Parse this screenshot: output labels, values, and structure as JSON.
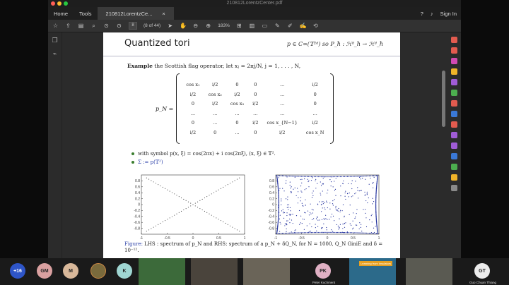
{
  "window": {
    "title": "210812LorentzCenter.pdf"
  },
  "topbar": {
    "home": "Home",
    "tools": "Tools",
    "tab_label": "210812LorentzCe...",
    "tab_close": "×",
    "sign_in": "Sign In"
  },
  "toolbar": {
    "page_number": "8",
    "page_total": "(8 of 44)",
    "zoom": "183%"
  },
  "slide": {
    "title": "Quantized tori",
    "header_formula": "p ∈ C∞(𝕋²ᵈ) so P_ħ : ℋᵈ_ħ → ℋᵈ_ħ",
    "example_bold": "Example",
    "example_text": " the Scottish flag operator, let xⱼ = 2πj/N, j = 1, . . . , N,",
    "matrix_label": "p_N =",
    "matrix_rows": [
      [
        "cos x₁",
        "i/2",
        "0",
        "0",
        "...",
        "i/2"
      ],
      [
        "i/2",
        "cos x₂",
        "i/2",
        "0",
        "...",
        "0"
      ],
      [
        "0",
        "i/2",
        "cos x₃",
        "i/2",
        "...",
        "0"
      ],
      [
        "...",
        "...",
        "...",
        "...",
        "...",
        "..."
      ],
      [
        "0",
        "...",
        "0",
        "i/2",
        "cos x_{N−1}",
        "i/2"
      ],
      [
        "i/2",
        "0",
        "...",
        "0",
        "i/2",
        "cos x_N"
      ]
    ],
    "bullet1": "with symbol p(x, ξ) = cos(2πx) + i cos(2πξ), (x, ξ) ∈ 𝕋².",
    "bullet2": "Σ := p(𝕋²)",
    "caption_fig": "Figure:",
    "caption_text": " LHS : spectrum of p_N and RHS: spectrum of a p_N + δQ_N, for N = 1000, Q_N GiniE and δ = 10⁻¹²."
  },
  "chart_data": [
    {
      "type": "scatter",
      "x_ticks": [
        "-1",
        "-0.5",
        "0",
        "0.5",
        "1"
      ],
      "y_ticks": [
        "-0.8",
        "-0.6",
        "-0.4",
        "-0.2",
        "0",
        "0.2",
        "0.4",
        "0.6",
        "0.8"
      ],
      "xlim": [
        -1,
        1
      ],
      "ylim": [
        -1,
        1
      ],
      "series": [
        {
          "pattern": "two diagonals y = x and y = -x",
          "color": "#333333"
        }
      ]
    },
    {
      "type": "scatter",
      "x_ticks": [
        "-1",
        "-0.5",
        "0",
        "0.5",
        "1"
      ],
      "y_ticks": [
        "-0.8",
        "-0.6",
        "-0.4",
        "-0.2",
        "0",
        "0.2",
        "0.4",
        "0.6",
        "0.8"
      ],
      "xlim": [
        -1,
        1
      ],
      "ylim": [
        -1,
        1
      ],
      "series": [
        {
          "pattern": "points filling the square with dense boundary",
          "color": "#1f2e9c"
        }
      ]
    }
  ],
  "participants": {
    "more_count": "+16",
    "avatars": [
      {
        "initials": "GM",
        "color": "#d9a0a0"
      },
      {
        "initials": "M",
        "color": "#d8b89a"
      },
      {
        "initials": "K",
        "color": "#9fd6d2"
      },
      {
        "initials": "PK",
        "color": "#e0b0c4"
      },
      {
        "initials": "GT",
        "color": "#ececec"
      }
    ],
    "names": {
      "peter": "Peter Kuchment",
      "guo": "Guo Chuan Thiang"
    },
    "banner": "Learning from Insulators"
  }
}
